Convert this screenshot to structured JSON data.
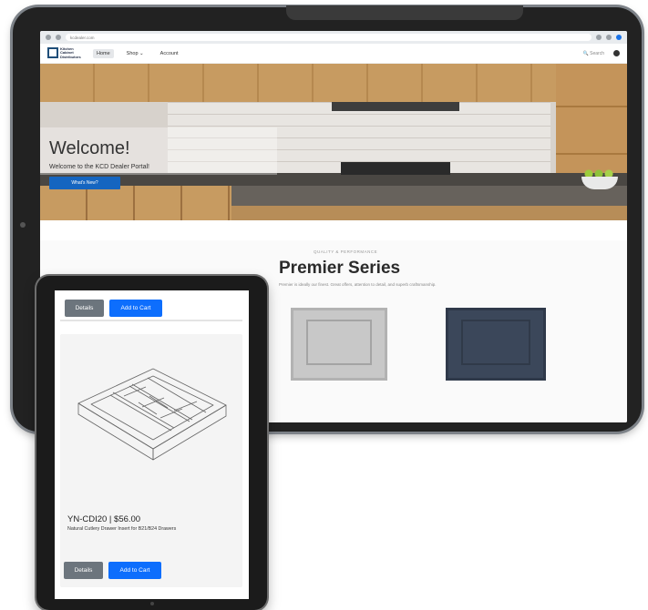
{
  "browser": {
    "url": "kcdealer.com"
  },
  "site": {
    "logo_text": "Kitchen Cabinet Distributors",
    "nav": {
      "items": [
        {
          "label": "Home",
          "active": true
        },
        {
          "label": "Shop ⌄",
          "active": false
        },
        {
          "label": "Account",
          "active": false
        }
      ],
      "search_placeholder": "Search"
    },
    "hero": {
      "title": "Welcome!",
      "subtitle": "Welcome to the KCD Dealer Portal!",
      "cta_label": "What's New?"
    },
    "section": {
      "eyebrow": "QUALITY & PERFORMANCE",
      "title": "Premier Series",
      "description": "Premier is ideally our finest. Great offers, attention to detail, and superb craftsmanship."
    }
  },
  "mobile": {
    "top_card": {
      "details_label": "Details",
      "cart_label": "Add to Cart"
    },
    "product": {
      "sku_price": "YN-CDI20 | $56.00",
      "name": "Natural Cutlery Drawer Insert for B21/B24 Drawers",
      "details_label": "Details",
      "cart_label": "Add to Cart",
      "image_icon": "drawer-insert-illustration"
    }
  },
  "colors": {
    "primary_button": "#0d6efd",
    "secondary_button": "#6c757d",
    "hero_cta": "#1565c0"
  }
}
